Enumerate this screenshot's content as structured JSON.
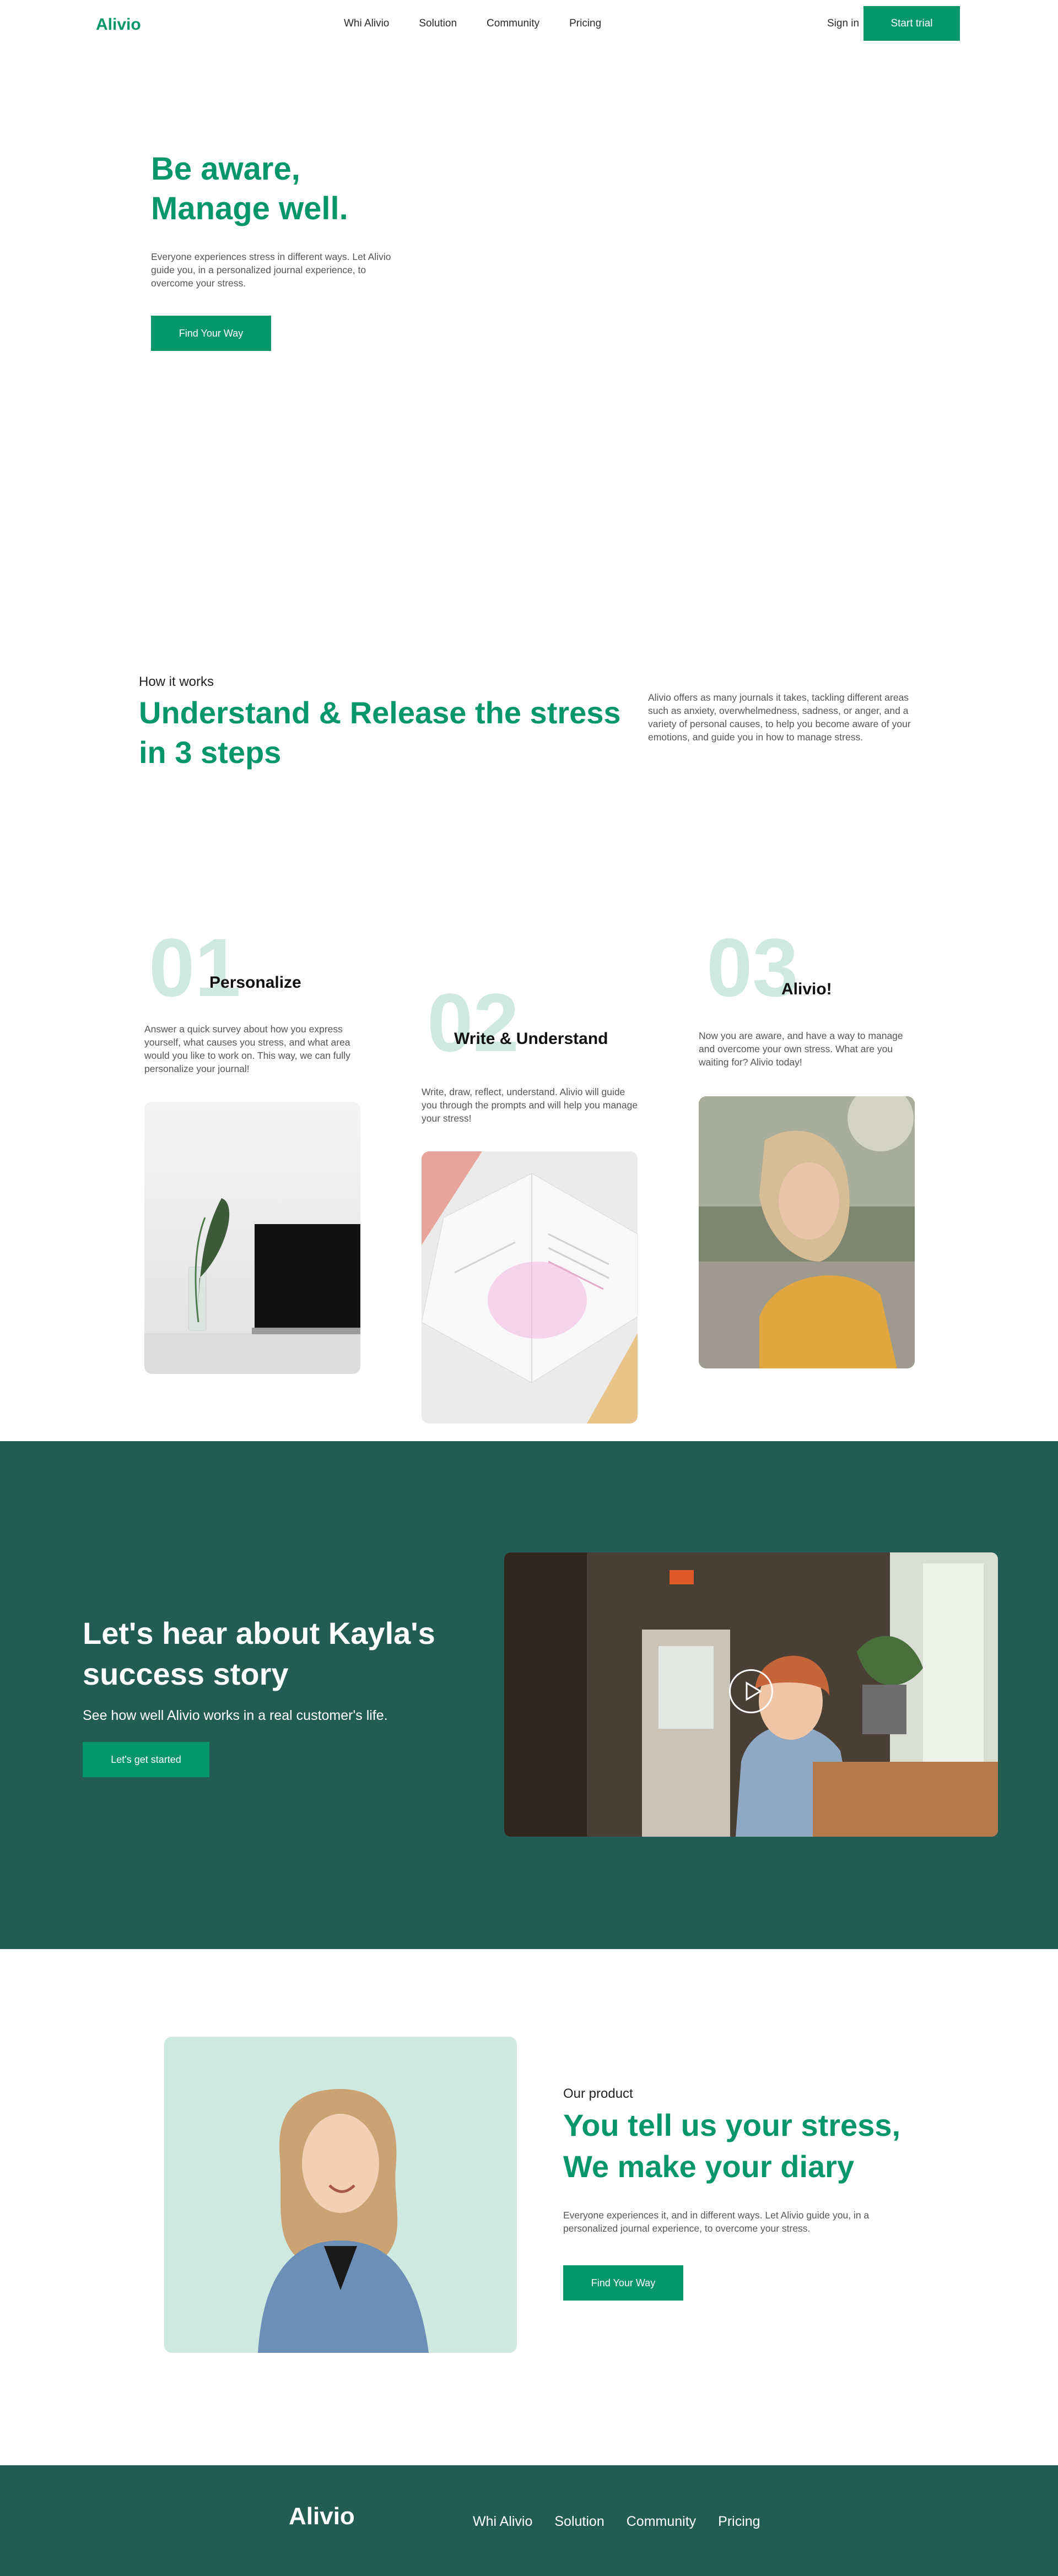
{
  "brand": {
    "name": "Alivio",
    "accent": "#059669",
    "dark": "#235c52",
    "mint": "#cde9e0"
  },
  "nav": {
    "links": [
      "Whi Alivio",
      "Solution",
      "Community",
      "Pricing"
    ],
    "signin": "Sign in",
    "cta": "Start trial"
  },
  "hero": {
    "title_line1": "Be aware,",
    "title_line2": "Manage well.",
    "text": "Everyone experiences stress in different ways. Let Alivio guide you, in a personalized journal experience, to overcome your stress.",
    "cta": "Find Your Way"
  },
  "how": {
    "kicker": "How it works",
    "title": "Understand & Release the stress in 3 steps",
    "side_text": "Alivio offers as many journals it takes, tackling different areas such as anxiety, overwhelmedness, sadness, or anger, and a variety of personal causes, to help you become aware of your emotions, and guide you in how to manage stress.",
    "steps": [
      {
        "num": "01",
        "title": "Personalize",
        "text": "Answer a quick survey about how you express yourself, what causes you stress, and what area would you like to work on. This way, we can fully personalize your journal!"
      },
      {
        "num": "02",
        "title": "Write & Understand",
        "text": "Write, draw, reflect, understand. Alivio will guide you through the prompts and will help you manage your stress!"
      },
      {
        "num": "03",
        "title": "Alivio!",
        "text": "Now you are aware, and have a way to manage and overcome your own stress. What are you waiting for? Alivio today!"
      }
    ]
  },
  "story": {
    "title": "Let's hear about Kayla's success story",
    "subtitle": "See how well Alivio works in a real customer's life.",
    "cta": "Let's get started"
  },
  "product": {
    "kicker": "Our product",
    "title_line1": "You tell us your stress,",
    "title_line2": "We make your diary",
    "text": "Everyone experiences it, and in different ways. Let Alivio guide you, in a personalized journal experience, to overcome your stress.",
    "cta": "Find Your Way"
  },
  "footer": {
    "logo": "Alivio",
    "links": [
      "Whi Alivio",
      "Solution",
      "Community",
      "Pricing"
    ]
  }
}
